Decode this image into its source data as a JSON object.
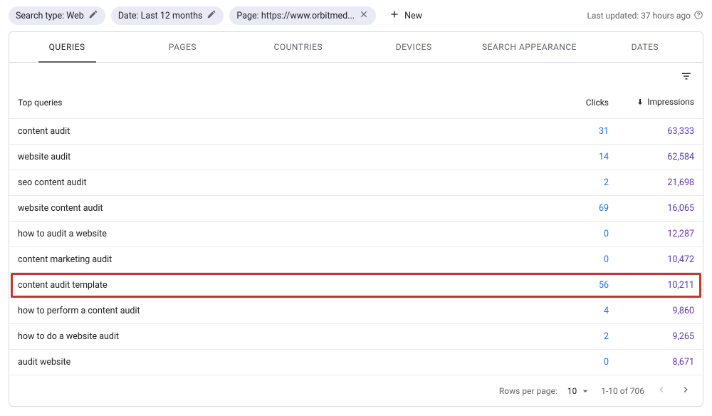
{
  "filters": {
    "search_type": "Search type: Web",
    "date": "Date: Last 12 months",
    "page": "Page: https://www.orbitmed...",
    "new_label": "New"
  },
  "last_updated": "Last updated: 37 hours ago",
  "tabs": {
    "queries": "QUERIES",
    "pages": "PAGES",
    "countries": "COUNTRIES",
    "devices": "DEVICES",
    "search_appearance": "SEARCH APPEARANCE",
    "dates": "DATES"
  },
  "columns": {
    "top_queries": "Top queries",
    "clicks": "Clicks",
    "impressions": "Impressions"
  },
  "rows": [
    {
      "q": "content audit",
      "c": "31",
      "i": "63,333"
    },
    {
      "q": "website audit",
      "c": "14",
      "i": "62,584"
    },
    {
      "q": "seo content audit",
      "c": "2",
      "i": "21,698"
    },
    {
      "q": "website content audit",
      "c": "69",
      "i": "16,065"
    },
    {
      "q": "how to audit a website",
      "c": "0",
      "i": "12,287"
    },
    {
      "q": "content marketing audit",
      "c": "0",
      "i": "10,472"
    },
    {
      "q": "content audit template",
      "c": "56",
      "i": "10,211"
    },
    {
      "q": "how to perform a content audit",
      "c": "4",
      "i": "9,860"
    },
    {
      "q": "how to do a website audit",
      "c": "2",
      "i": "9,265"
    },
    {
      "q": "audit website",
      "c": "0",
      "i": "8,671"
    }
  ],
  "highlight_index": 6,
  "footer": {
    "rows_per_page_label": "Rows per page:",
    "rows_per_page_value": "10",
    "range": "1-10 of 706"
  }
}
